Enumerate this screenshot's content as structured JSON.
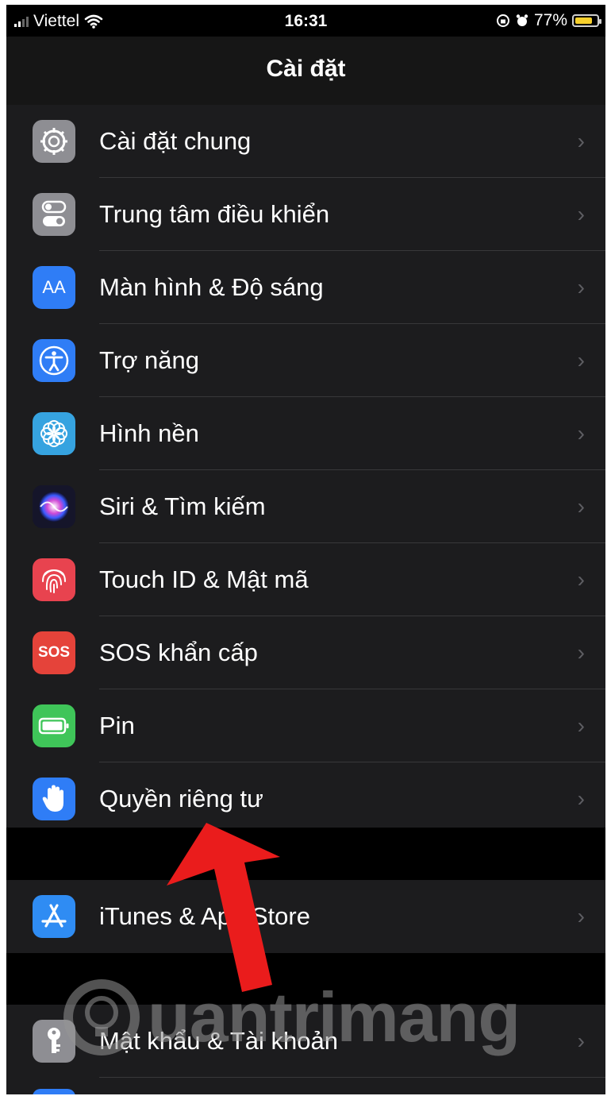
{
  "status": {
    "carrier": "Viettel",
    "time": "16:31",
    "battery": "77%"
  },
  "nav": {
    "title": "Cài đặt"
  },
  "group1": [
    {
      "label": "Cài đặt chung",
      "icon": "gear-icon",
      "color": "#8e8e93"
    },
    {
      "label": "Trung tâm điều khiển",
      "icon": "toggles-icon",
      "color": "#8e8e93"
    },
    {
      "label": "Màn hình & Độ sáng",
      "icon": "text-size-icon",
      "color": "#2f7df6",
      "glyph": "AA"
    },
    {
      "label": "Trợ năng",
      "icon": "accessibility-icon",
      "color": "#2f7df6"
    },
    {
      "label": "Hình nền",
      "icon": "wallpaper-flower-icon",
      "color": "#36a3e0"
    },
    {
      "label": "Siri & Tìm kiếm",
      "icon": "siri-icon",
      "color": "#15152a"
    },
    {
      "label": "Touch ID & Mật mã",
      "icon": "fingerprint-icon",
      "color": "#e8434f"
    },
    {
      "label": "SOS khẩn cấp",
      "icon": "sos-icon",
      "color": "#e5433a",
      "glyph": "SOS"
    },
    {
      "label": "Pin",
      "icon": "battery-icon",
      "color": "#3fc559"
    },
    {
      "label": "Quyền riêng tư",
      "icon": "hand-icon",
      "color": "#2f7df6"
    }
  ],
  "group2": [
    {
      "label": "iTunes & App Store",
      "icon": "app-store-icon",
      "color": "#2f8cf3"
    }
  ],
  "group3": [
    {
      "label": "Mật khẩu & Tài khoản",
      "icon": "key-icon",
      "color": "#8e8e93"
    }
  ],
  "chevron": "›",
  "watermark": "uantrimang"
}
